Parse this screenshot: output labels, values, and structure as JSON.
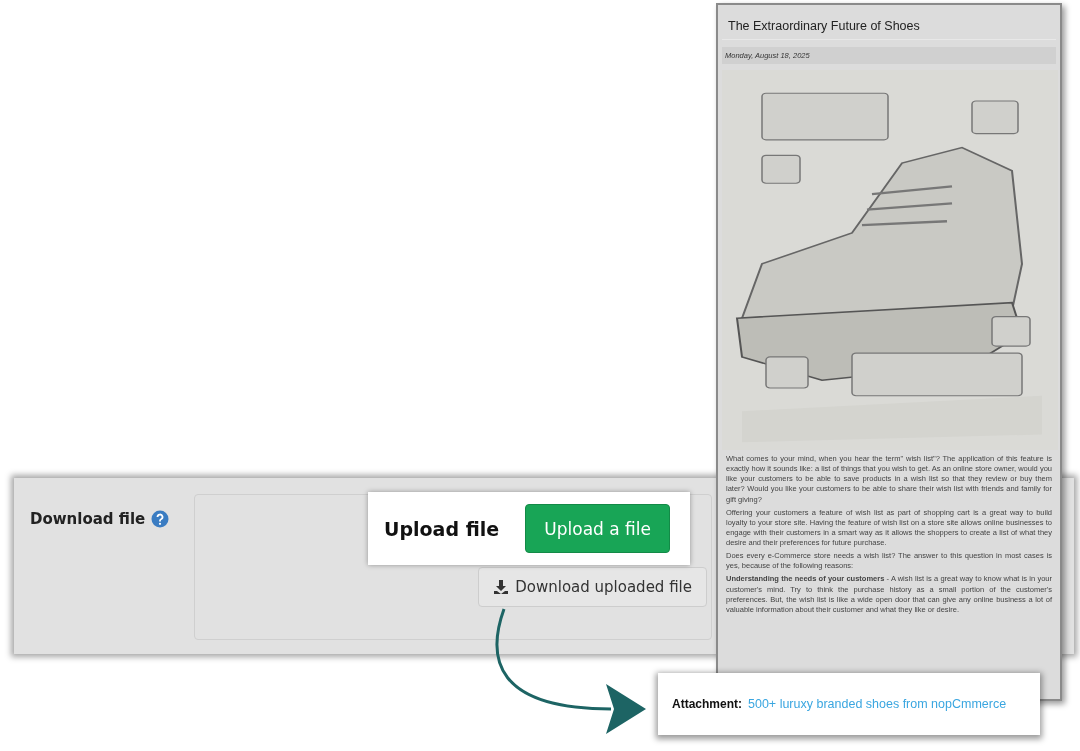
{
  "settings_panel": {
    "field_label": "Download file",
    "download_button": "Download uploaded file"
  },
  "upload_callout": {
    "label": "Upload file",
    "button": "Upload a file"
  },
  "article": {
    "title": "The Extraordinary Future of Shoes",
    "date": "Monday, August 18, 2025",
    "paragraphs": [
      "What comes to your mind, when you hear the term\" wish list\"? The application of this feature is exactly how it sounds like: a list of things that you wish to get. As an online store owner, would you like your customers to be able to save products in a wish list so that they review or buy them later? Would you like your customers to be able to share their wish list with friends and family for gift giving?",
      "Offering your customers a feature of wish list as part of shopping cart is a great way to build loyalty to your store site. Having the feature of wish list on a store site allows online businesses to engage with their customers in a smart way as it allows the shoppers to create a list of what they desire and their preferences for future purchase.",
      "Does every e-Commerce store needs a wish list? The answer to this question in most cases is yes, because of the following reasons:",
      "**Understanding the needs of your customers** - A wish list is a great way to know what is in your customer's mind. Try to think the purchase history as a small portion of the customer's preferences. But, the wish list is like a wide open door that can give any online business a lot of valuable information about their customer and what they like or desire."
    ]
  },
  "attachment_callout": {
    "label": "Attachment:",
    "link": "500+ luruxy branded shoes from nopCmmerce"
  }
}
